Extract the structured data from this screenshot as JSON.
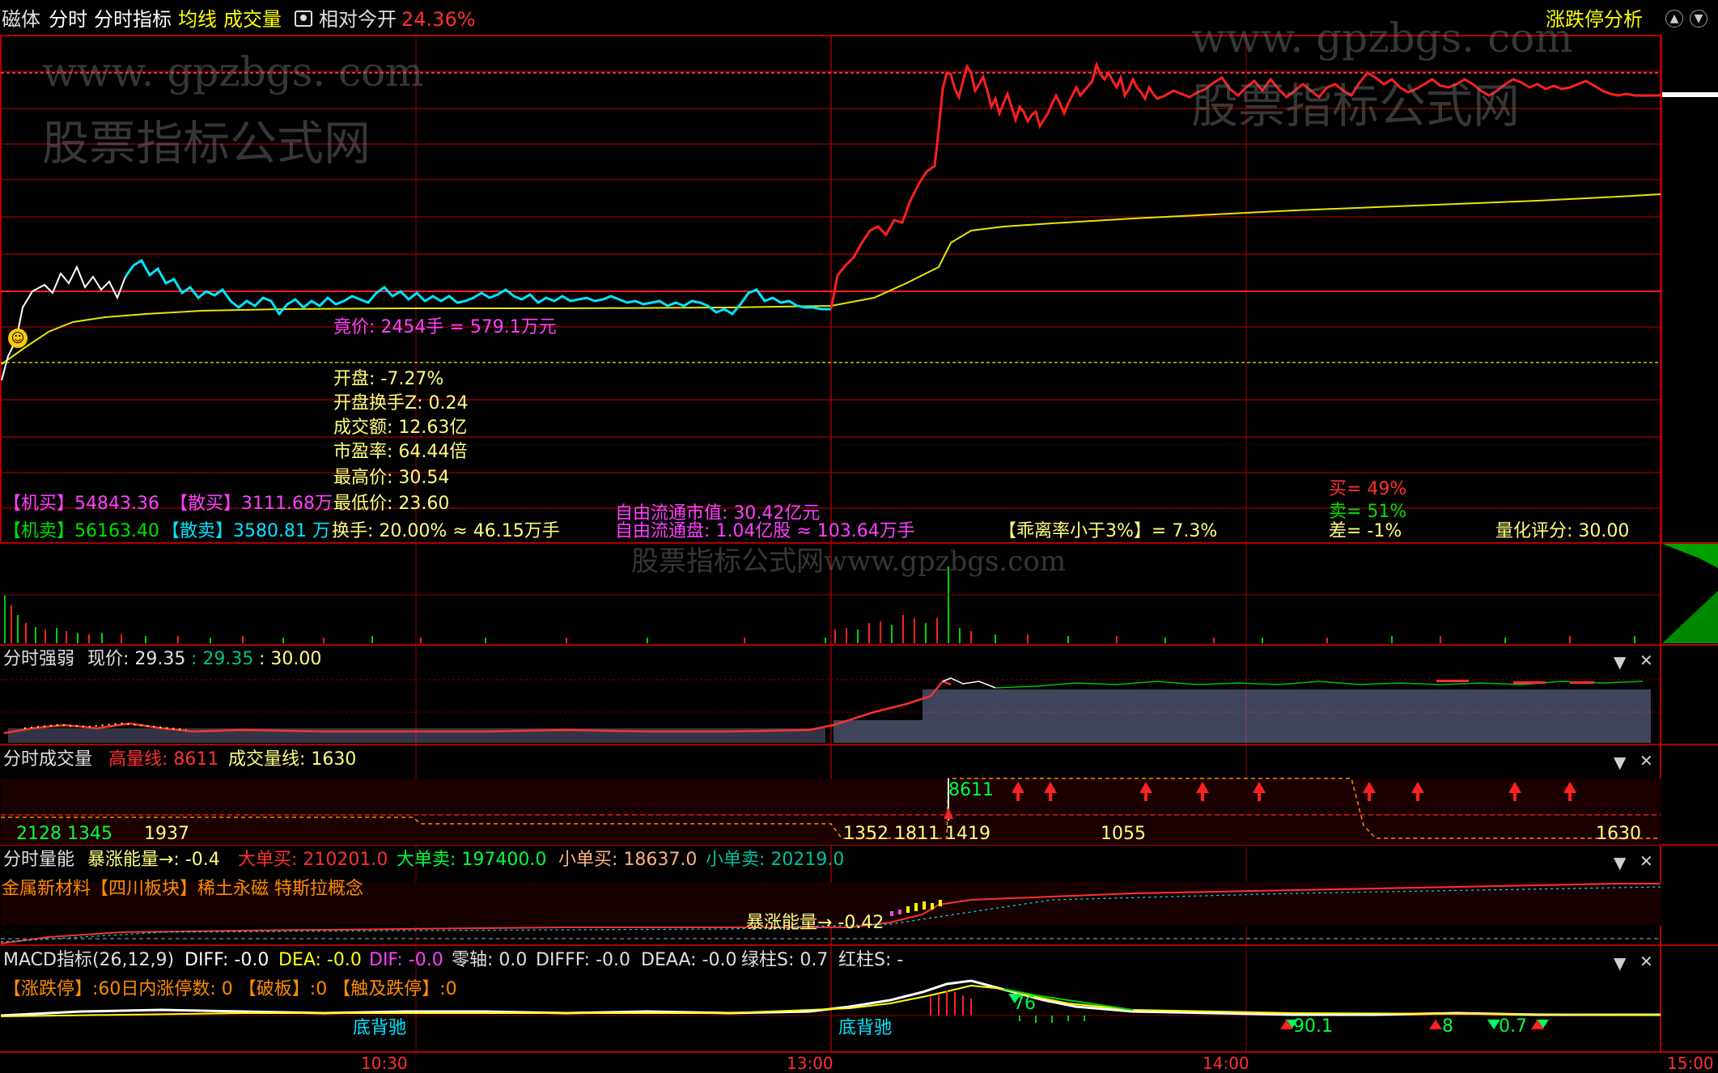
{
  "toolbar": {
    "items": [
      "磁体",
      "分时",
      "分时指标",
      "均线",
      "成交量",
      "相对今开",
      "24.36%"
    ],
    "right_label": "涨跌停分析"
  },
  "watermark": {
    "url": "www. gpzbgs. com",
    "name": "股票指标公式网",
    "footer": "股票指标公式网www.gpzbgs.com"
  },
  "info": {
    "auction": "竟价: 2454手 = 579.1万元",
    "open": "开盘: -7.27%",
    "open_turnover": "开盘换手Z: 0.24",
    "amount": "成交额: 12.63亿",
    "pe": "市盈率: 64.44倍",
    "high": "最高价: 30.54",
    "low": "最低价: 23.60",
    "turnover": "换手: 20.00% ≈ 46.15万手",
    "inst_buy": "【机买】54843.36",
    "retail_buy": "【散买】3111.68万",
    "inst_sell": "【机卖】56163.40",
    "retail_sell": "【散卖】3580.81 万",
    "free_cap": "自由流通市值: 30.42亿元",
    "free_float": "自由流通盘: 1.04亿股 ≈ 103.64万手",
    "deviation": "【乖离率小于3%】= 7.3%",
    "buy_pct": "买= 49%",
    "sell_pct": "卖= 51%",
    "diff_pct": "差= -1%",
    "score": "量化评分: 30.00"
  },
  "panel_strength": {
    "name": "分时强弱",
    "price_label": "现价: 29.35",
    "v1": ": 29.35",
    "v2": ": 30.00"
  },
  "panel_volume": {
    "name": "分时成交量",
    "high_line": "高量线: 8611",
    "vol_line": "成交量线: 1630",
    "lbl_8611": "8611",
    "lbl_1937": "1937",
    "lbl_1055": "1055",
    "lbl_1630": "1630",
    "lbl_left": "2128 1345",
    "lbl_mid": "1352 1811 1419"
  },
  "panel_energy": {
    "name": "分时量能",
    "surge": "暴涨能量→: -0.4",
    "big_buy": "大单买: 210201.0",
    "big_sell": "大单卖: 197400.0",
    "small_buy": "小单买: 18637.0",
    "small_sell": "小单卖: 20219.0",
    "concepts": "金属新材料【四川板块】稀土永磁 特斯拉概念",
    "surge_label": "暴涨能量→ -0.42"
  },
  "panel_macd": {
    "name": "MACD指标(26,12,9)",
    "diff": "DIFF: -0.0",
    "dea": "DEA: -0.0",
    "dif": "DIF: -0.0",
    "zero": "零轴: 0.0",
    "difff": "DIFFF: -0.0",
    "deaa": "DEAA: -0.0",
    "green": "绿柱S: 0.7",
    "red": "红柱S: -",
    "limit_line": "【涨跌停】:60日内涨停数: 0 【破板】:0 【触及跌停】:0",
    "div1": "底背驰",
    "div2": "底背驰",
    "m1": "76",
    "m2": "90.1",
    "m3": "8",
    "m4": "0.7"
  },
  "time_axis": [
    "10:30",
    "13:00",
    "14:00",
    "15:00"
  ],
  "colors": {
    "red": "#ff2020",
    "yellow": "#ffff00",
    "cyan": "#00e5ff",
    "magenta": "#ff40ff",
    "green": "#00d000",
    "orange": "#ff8c00"
  }
}
